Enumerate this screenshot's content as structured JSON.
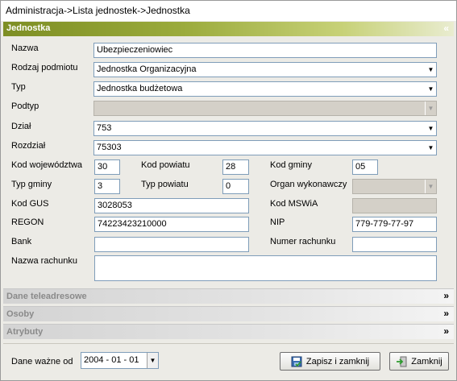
{
  "breadcrumb": "Administracja->Lista  jednostek->Jednostka",
  "sections": {
    "main": {
      "title": "Jednostka",
      "toggle": "«"
    },
    "contacts": {
      "title": "Dane teleadresowe",
      "toggle": "»"
    },
    "persons": {
      "title": "Osoby",
      "toggle": "»"
    },
    "attributes": {
      "title": "Atrybuty",
      "toggle": "»"
    }
  },
  "form": {
    "nazwa": {
      "label": "Nazwa",
      "value": "Ubezpieczeniowiec"
    },
    "rodzaj": {
      "label": "Rodzaj podmiotu",
      "value": "Jednostka Organizacyjna"
    },
    "typ": {
      "label": "Typ",
      "value": "Jednostka budżetowa"
    },
    "podtyp": {
      "label": "Podtyp",
      "value": ""
    },
    "dzial": {
      "label": "Dział",
      "value": "753"
    },
    "rozdzial": {
      "label": "Rozdział",
      "value": "75303"
    },
    "kod_woj": {
      "label": "Kod województwa",
      "value": "30"
    },
    "kod_pow": {
      "label": "Kod powiatu",
      "value": "28"
    },
    "kod_gminy": {
      "label": "Kod gminy",
      "value": "05"
    },
    "typ_gminy": {
      "label": "Typ gminy",
      "value": "3"
    },
    "typ_pow": {
      "label": "Typ powiatu",
      "value": "0"
    },
    "organ": {
      "label": "Organ wykonawczy",
      "value": ""
    },
    "kod_gus": {
      "label": "Kod GUS",
      "value": "3028053"
    },
    "kod_mswia": {
      "label": "Kod MSWiA",
      "value": ""
    },
    "regon": {
      "label": "REGON",
      "value": "74223423210000"
    },
    "nip": {
      "label": "NIP",
      "value": "779-779-77-97"
    },
    "bank": {
      "label": "Bank",
      "value": ""
    },
    "numer_rach": {
      "label": "Numer rachunku",
      "value": ""
    },
    "nazwa_rach": {
      "label": "Nazwa rachunku",
      "value": ""
    }
  },
  "footer": {
    "valid_label": "Dane ważne od",
    "valid_date": "2004 - 01 - 01",
    "save_close": "Zapisz i zamknij",
    "close": "Zamknij"
  },
  "icons": {
    "save": "save-disk-icon",
    "close": "exit-door-icon",
    "dropdown": "chevron-down-icon"
  }
}
